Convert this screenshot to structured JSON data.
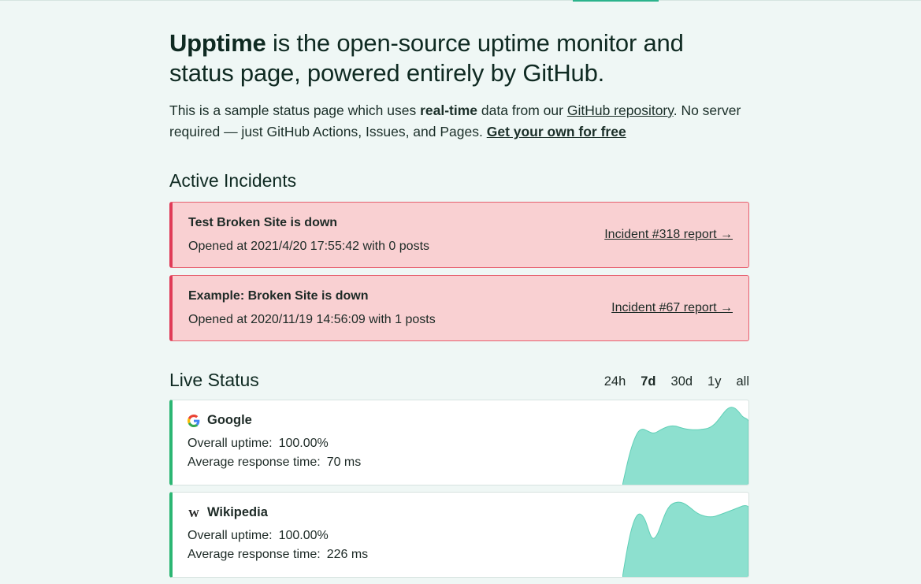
{
  "hero": {
    "brand": "Upptime",
    "title_rest": " is the open-source uptime monitor and status page, powered entirely by GitHub."
  },
  "intro": {
    "part1": "This is a sample status page which uses ",
    "bold": "real-time",
    "part2": " data from our ",
    "repo_link": "GitHub repository",
    "part3": ". No server required — just GitHub Actions, Issues, and Pages. ",
    "cta_link": "Get your own for free"
  },
  "incidents": {
    "title": "Active Incidents",
    "items": [
      {
        "title": "Test Broken Site is down",
        "meta": "Opened at 2021/4/20 17:55:42 with 0 posts",
        "link": "Incident #318 report →"
      },
      {
        "title": "Example: Broken Site is down",
        "meta": "Opened at 2020/11/19 14:56:09 with 1 posts",
        "link": "Incident #67 report →"
      }
    ]
  },
  "live_status": {
    "title": "Live Status",
    "ranges": [
      "24h",
      "7d",
      "30d",
      "1y",
      "all"
    ],
    "active_range": "7d",
    "sites": [
      {
        "name": "Google",
        "icon": "google-icon",
        "uptime_label": "Overall uptime:",
        "uptime": "100.00%",
        "response_label": "Average response time:",
        "response": "70 ms"
      },
      {
        "name": "Wikipedia",
        "icon": "wikipedia-icon",
        "uptime_label": "Overall uptime:",
        "uptime": "100.00%",
        "response_label": "Average response time:",
        "response": "226 ms"
      }
    ]
  },
  "colors": {
    "background": "#eff7f5",
    "incident_bg": "#f9d0d2",
    "incident_border": "#e03b57",
    "up_border": "#2bb673",
    "sparkline_fill": "#8de0cf"
  }
}
